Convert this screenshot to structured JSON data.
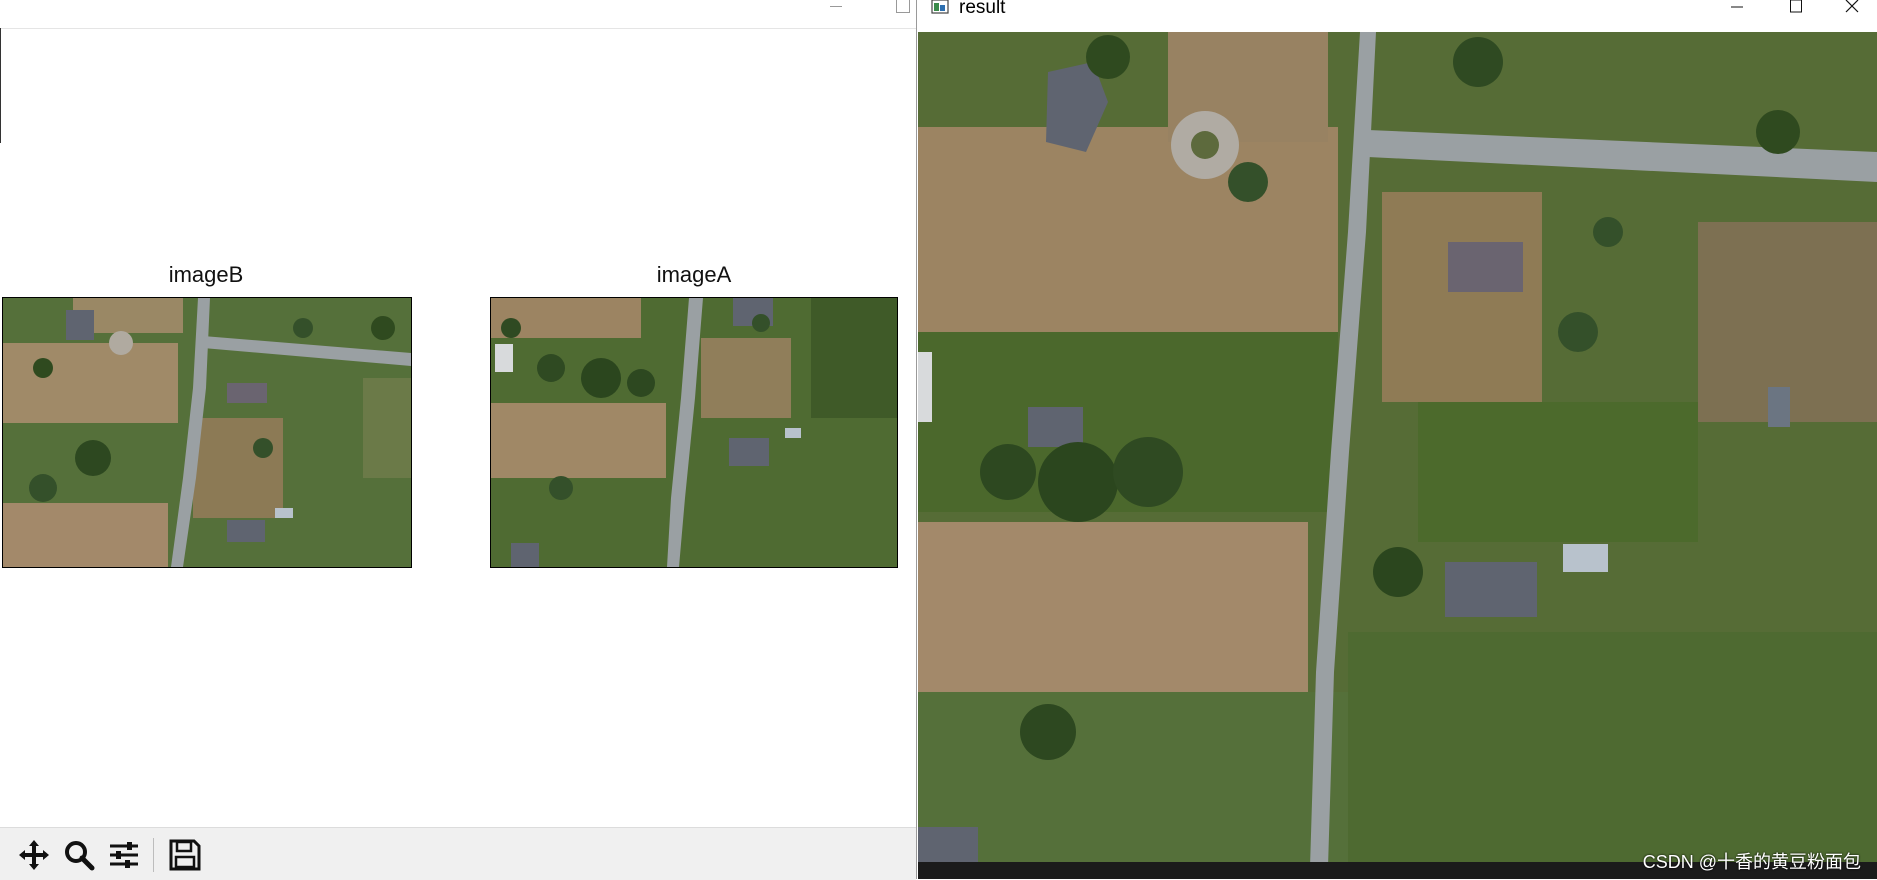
{
  "plot_window": {
    "subplots": [
      {
        "title": "imageB",
        "image_alt": "aerial view of houses and road (image B)"
      },
      {
        "title": "imageA",
        "image_alt": "aerial view of houses and road (image A)"
      }
    ],
    "toolbar": {
      "buttons": [
        {
          "name": "pan-button",
          "icon": "move-arrows-icon"
        },
        {
          "name": "zoom-button",
          "icon": "magnifier-icon"
        },
        {
          "name": "configure-subplots-button",
          "icon": "sliders-icon"
        },
        {
          "name": "save-button",
          "icon": "floppy-disk-icon"
        }
      ]
    }
  },
  "result_window": {
    "title": "result",
    "controls": [
      "minimize",
      "maximize",
      "close"
    ],
    "image_alt": "stitched panorama aerial image"
  },
  "watermark": "CSDN @十香的黄豆粉面包",
  "colors": {
    "field_dry": "#9c8462",
    "grass": "#4e6b2d",
    "road": "#9aa0a3",
    "roof": "#5f6470"
  }
}
